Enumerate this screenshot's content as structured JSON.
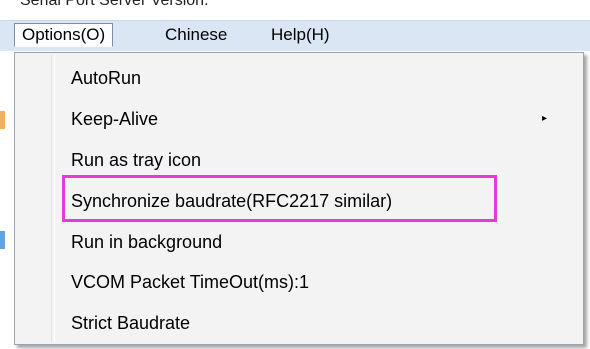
{
  "window": {
    "title": "Serial Port Server Version."
  },
  "menubar": {
    "items": [
      {
        "label": "Options(O)",
        "active": true
      },
      {
        "label": "Chinese",
        "active": false
      },
      {
        "label": "Help(H)",
        "active": false
      }
    ]
  },
  "options_menu": {
    "items": [
      {
        "label": "AutoRun",
        "has_submenu": false
      },
      {
        "label": "Keep-Alive",
        "has_submenu": true
      },
      {
        "label": "Run as tray icon",
        "has_submenu": false
      },
      {
        "label": "Synchronize baudrate(RFC2217 similar)",
        "has_submenu": false,
        "highlighted": true
      },
      {
        "label": "Run in background",
        "has_submenu": false
      },
      {
        "label": "VCOM Packet TimeOut(ms):1",
        "has_submenu": false
      },
      {
        "label": "Strict Baudrate",
        "has_submenu": false
      }
    ],
    "submenu_arrow": "▸"
  },
  "colors": {
    "menubar_background": "#dbe6f5",
    "menu_background": "#f3f3f3",
    "highlight_border": "#e63ad8"
  }
}
